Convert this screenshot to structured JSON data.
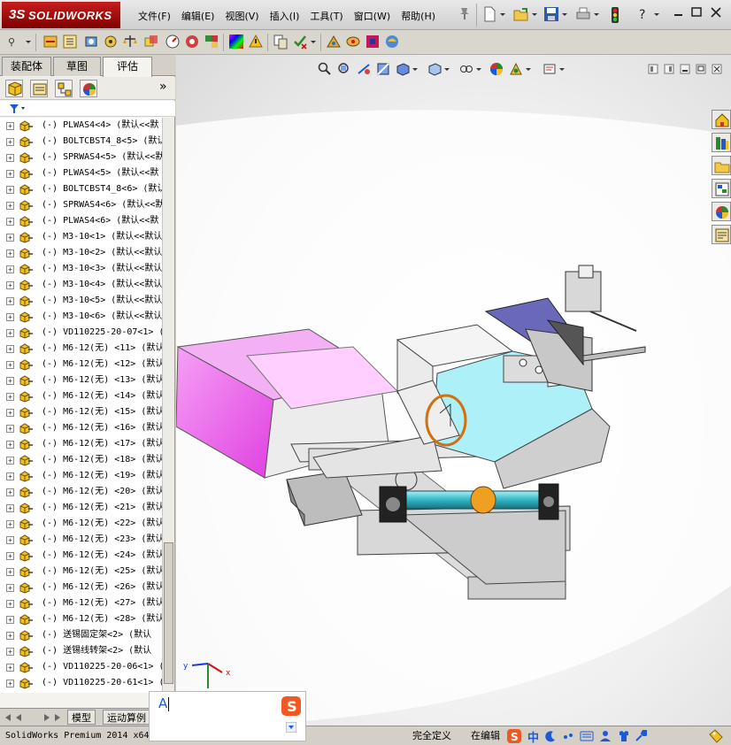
{
  "app": {
    "logo_ds": "3S",
    "logo_text": "SOLIDWORKS"
  },
  "menu": [
    "文件(F)",
    "编辑(E)",
    "视图(V)",
    "插入(I)",
    "工具(T)",
    "窗口(W)",
    "帮助(H)"
  ],
  "left_panel": {
    "tabs": [
      "装配体",
      "草图",
      "评估"
    ],
    "active_tab": "评估",
    "more_label": "»",
    "tree_items": [
      "(-) PLWAS4<4> (默认<<默",
      "(-) BOLTCBST4_8<5> (默认",
      "(-) SPRWAS4<5> (默认<<默",
      "(-) PLWAS4<5> (默认<<默",
      "(-) BOLTCBST4_8<6> (默认",
      "(-) SPRWAS4<6> (默认<<默",
      "(-) PLWAS4<6> (默认<<默",
      "(-) M3-10<1> (默认<<默认",
      "(-) M3-10<2> (默认<<默认",
      "(-) M3-10<3> (默认<<默认",
      "(-) M3-10<4> (默认<<默认",
      "(-) M3-10<5> (默认<<默认",
      "(-) M3-10<6> (默认<<默认",
      "(-) VD110225-20-07<1> (",
      "(-) M6-12(无) <11> (默认",
      "(-) M6-12(无) <12> (默认",
      "(-) M6-12(无) <13> (默认",
      "(-) M6-12(无) <14> (默认",
      "(-) M6-12(无) <15> (默认",
      "(-) M6-12(无) <16> (默认",
      "(-) M6-12(无) <17> (默认",
      "(-) M6-12(无) <18> (默认",
      "(-) M6-12(无) <19> (默认",
      "(-) M6-12(无) <20> (默认",
      "(-) M6-12(无) <21> (默认",
      "(-) M6-12(无) <22> (默认",
      "(-) M6-12(无) <23> (默认",
      "(-) M6-12(无) <24> (默认",
      "(-) M6-12(无) <25> (默认",
      "(-) M6-12(无) <26> (默认",
      "(-) M6-12(无) <27> (默认",
      "(-) M6-12(无) <28> (默认",
      "(-) 送锡固定架<2> (默认",
      "(-) 送锡线转架<2> (默认",
      "(-) VD110225-20-06<1> (",
      "(-) VD110225-20-61<1> ("
    ],
    "bottom_tabs": [
      "模型",
      "运动算例"
    ]
  },
  "status": {
    "product": "SolidWorks Premium 2014 x64",
    "state": "完全定义",
    "mode": "在编辑"
  },
  "ime": {
    "input_text": "A",
    "lang_label": "中"
  },
  "colors": {
    "accent_red": "#b40000",
    "magenta_part": "#f07cf0",
    "cyan_part": "#aef0f8"
  }
}
